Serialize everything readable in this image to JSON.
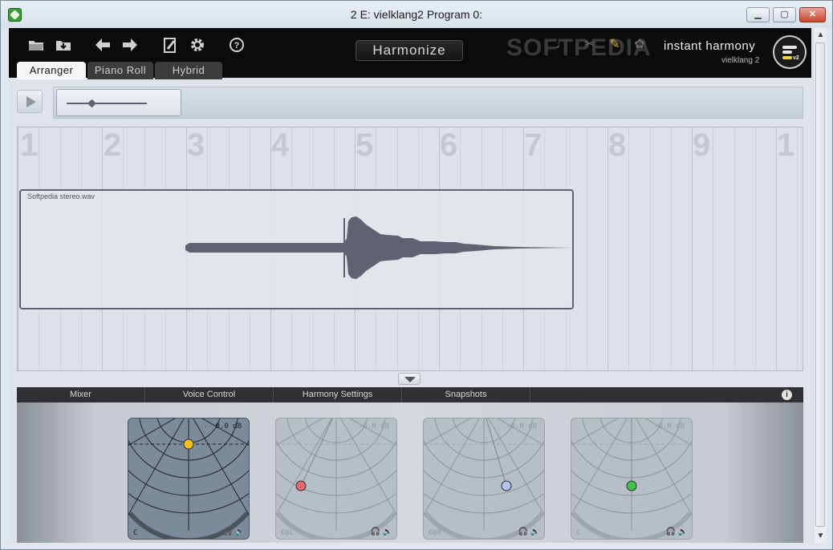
{
  "window": {
    "title": "2 E: vielklang2 Program 0:",
    "minimize": "▁",
    "maximize": "▢",
    "close": "✕"
  },
  "toolbar": {
    "icons": [
      "folder-open-icon",
      "folder-save-icon",
      "arrow-left-icon",
      "arrow-right-icon",
      "pencil-icon",
      "gear-icon",
      "help-icon"
    ],
    "harmonize_label": "Harmonize",
    "watermark": "SOFTPEDIA"
  },
  "brand": {
    "name": "instant harmony",
    "subtitle": "vielklang 2",
    "logo_badge": "v2"
  },
  "tabs": [
    {
      "label": "Arranger",
      "active": true
    },
    {
      "label": "Piano Roll",
      "active": false
    },
    {
      "label": "Hybrid",
      "active": false
    }
  ],
  "ruler": [
    "1",
    "2",
    "3",
    "4",
    "5",
    "6",
    "7",
    "8",
    "9",
    "1"
  ],
  "clip": {
    "name": "Softpedia stereo.wav"
  },
  "lower_tabs": [
    "Mixer",
    "Voice Control",
    "Harmony Settings",
    "Snapshots"
  ],
  "info_label": "i",
  "voices": [
    {
      "db": "0.0 dB",
      "pan": "C",
      "dot_color": "#f5c21d",
      "active": true
    },
    {
      "db": "-6.0 dB",
      "pan": "66L",
      "dot_color": "#e06a6a",
      "active": false
    },
    {
      "db": "-6.0 dB",
      "pan": "66R",
      "dot_color": "#b3c3ee",
      "active": false
    },
    {
      "db": "-6.0 dB",
      "pan": "C",
      "dot_color": "#3fc24a",
      "active": false
    }
  ],
  "icons": {
    "headphones": "🎧",
    "speaker": "🔈"
  },
  "scrollbar": {
    "up": "▲",
    "down": "▼"
  }
}
